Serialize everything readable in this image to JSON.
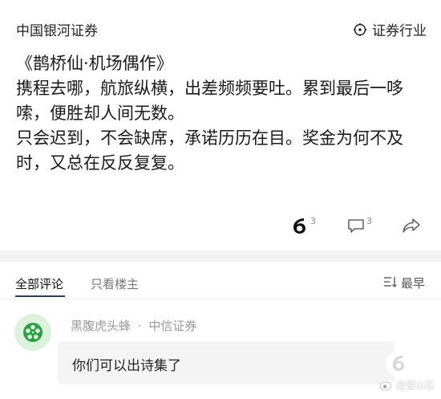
{
  "header": {
    "company": "中国银河证券",
    "industry_label": "证券行业",
    "industry_icon": "target-icon"
  },
  "post": {
    "title": "《鹊桥仙·机场偶作》",
    "lines": [
      "携程去哪，航旅纵横，出差频频要吐。累到最后一哆",
      "嗦，便胜却人间无数。",
      "只会迟到，不会缺席，承诺历历在目。奖金为何不及",
      "时，又总在反反复复。"
    ]
  },
  "actions": {
    "like_count": "3",
    "comment_count": "3",
    "share_icon": "share-icon",
    "like_icon": "like-six-icon",
    "comment_icon": "comment-icon"
  },
  "tabs": {
    "all_comments": "全部评论",
    "owner_only": "只看楼主",
    "sort_label": "最早",
    "sort_icon": "sort-list-icon"
  },
  "comment": {
    "username": "黑腹虎头蜂",
    "separator": "·",
    "company": "中信证券",
    "text": "你们可以出诗集了"
  },
  "watermark": {
    "text": "@雪山石"
  },
  "colors": {
    "divider": "#f3f3f3",
    "bubble": "#f4f4f4",
    "avatar_bg": "#dcf2dc",
    "tab_indicator": "#2c3e50"
  }
}
